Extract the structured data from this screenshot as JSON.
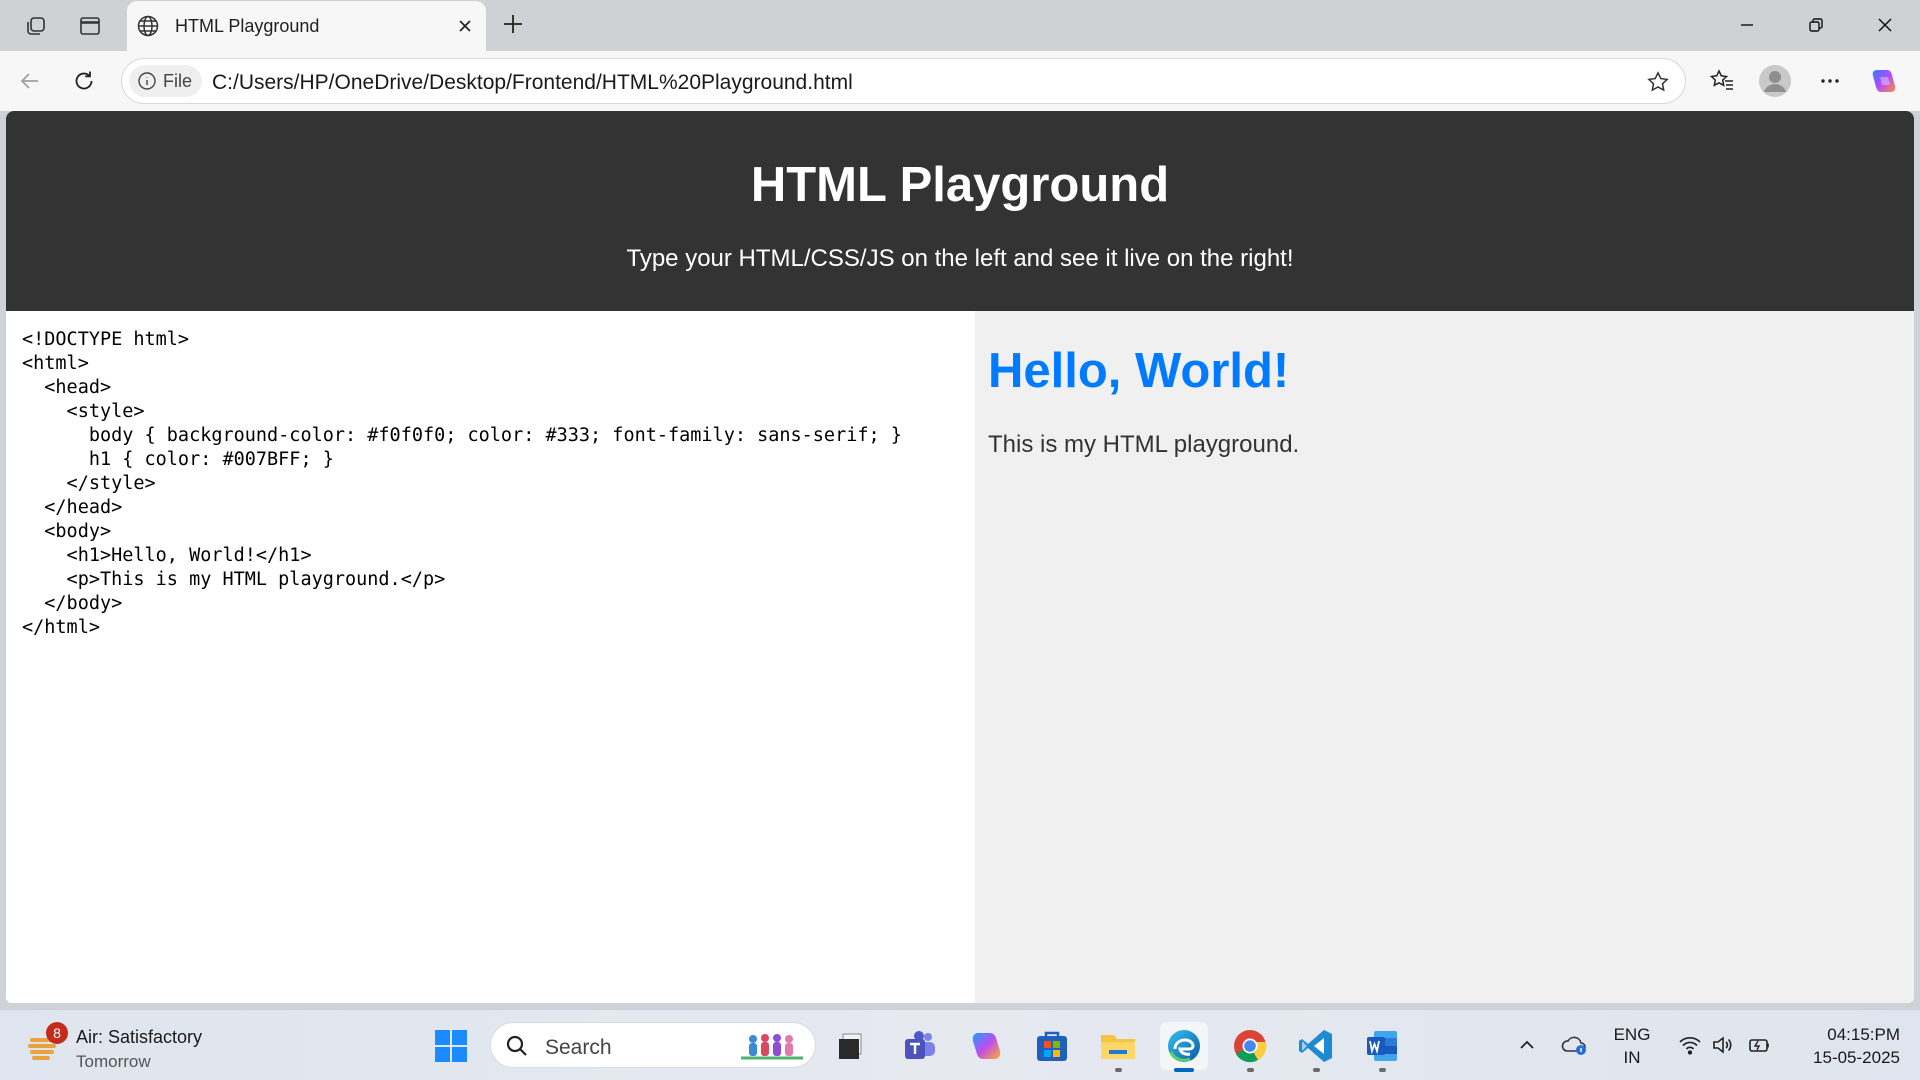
{
  "browser": {
    "tab": {
      "title": "HTML Playground"
    },
    "address": {
      "scheme_label": "File",
      "url": "C:/Users/HP/OneDrive/Desktop/Frontend/HTML%20Playground.html"
    },
    "icons": [
      "workspaces-icon",
      "vertical-tabs-icon",
      "globe-icon",
      "close-icon",
      "plus-icon",
      "minimize-icon",
      "restore-icon",
      "window-close-icon",
      "back-icon",
      "refresh-icon",
      "info-icon",
      "star-icon",
      "favorites-icon",
      "profile-icon",
      "more-icon",
      "copilot-icon"
    ]
  },
  "page": {
    "header": {
      "title": "HTML Playground",
      "subtitle": "Type your HTML/CSS/JS on the left and see it live on the right!"
    },
    "editor": {
      "code": "<!DOCTYPE html>\n<html>\n  <head>\n    <style>\n      body { background-color: #f0f0f0; color: #333; font-family: sans-serif; }\n      h1 { color: #007BFF; }\n    </style>\n  </head>\n  <body>\n    <h1>Hello, World!</h1>\n    <p>This is my HTML playground.</p>\n  </body>\n</html>"
    },
    "preview": {
      "heading": "Hello, World!",
      "paragraph": "This is my HTML playground.",
      "background": "#f0f0f0",
      "text_color": "#333",
      "heading_color": "#007BFF"
    },
    "header_background": "#333333"
  },
  "taskbar": {
    "weather": {
      "line1": "Air: Satisfactory",
      "line2": "Tomorrow",
      "badge": "8"
    },
    "search": {
      "label": "Search"
    },
    "apps": [
      "start-icon",
      "file-explorer-icon",
      "teams-icon",
      "copilot-app-icon",
      "store-icon",
      "folder-icon",
      "edge-icon",
      "chrome-icon",
      "vscode-icon",
      "word-icon"
    ],
    "tray": {
      "lang_line1": "ENG",
      "lang_line2": "IN",
      "time": "04:15:PM",
      "date": "15-05-2025"
    }
  }
}
